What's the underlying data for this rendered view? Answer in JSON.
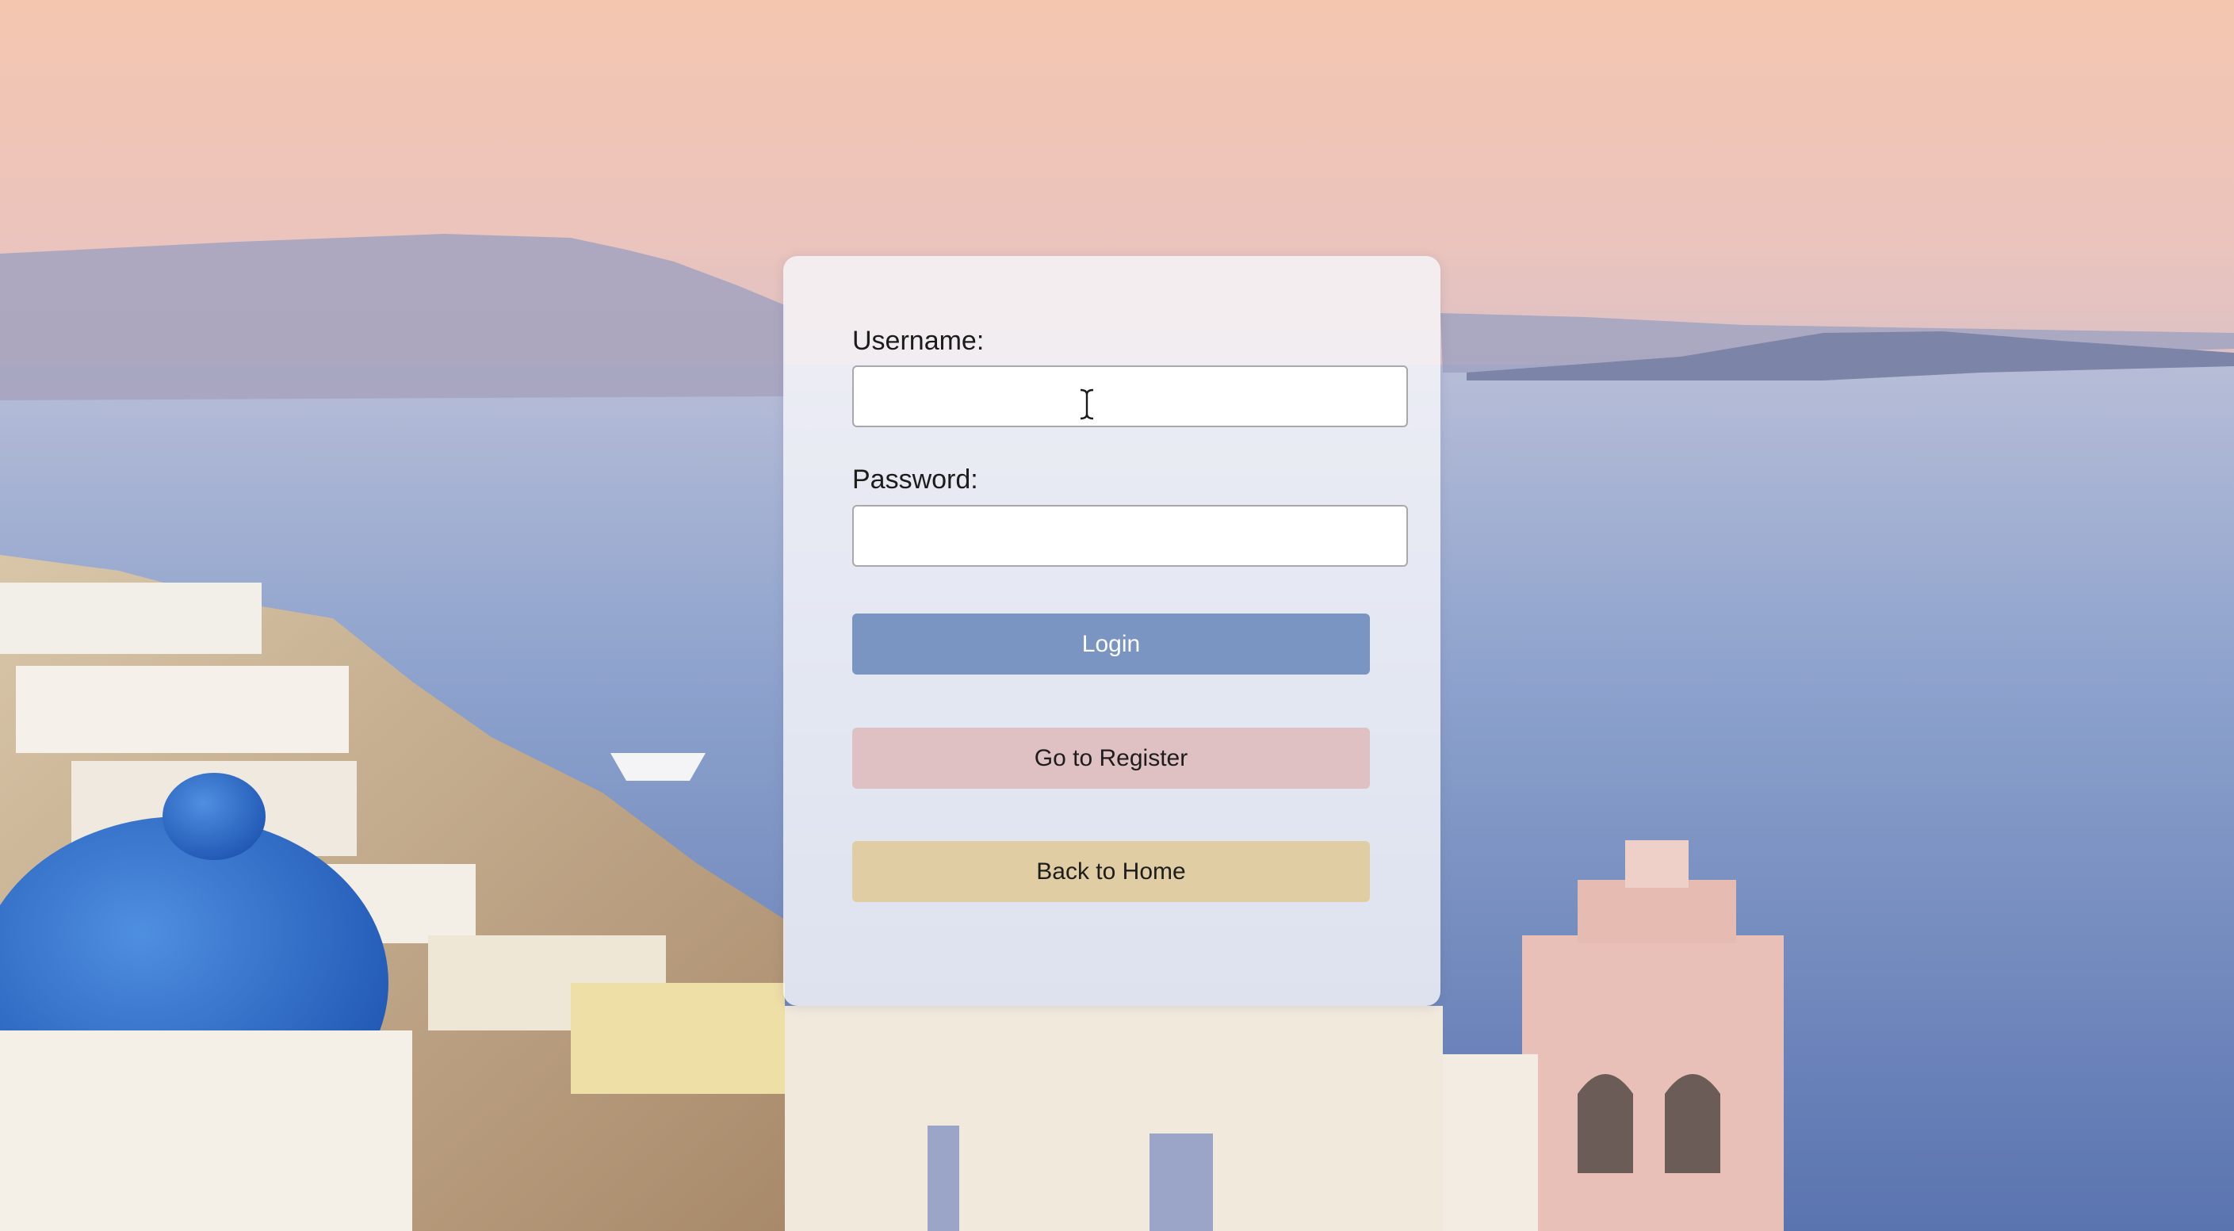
{
  "login_form": {
    "username_label": "Username:",
    "username_value": "",
    "password_label": "Password:",
    "password_value": "",
    "login_button": "Login",
    "register_button": "Go to Register",
    "home_button": "Back to Home"
  },
  "colors": {
    "login_button": "#7a95c2",
    "register_button": "#dfc0c3",
    "home_button": "#e0cda3",
    "card_background": "#f6f6fa"
  },
  "icons": {
    "cursor": "text-cursor-icon"
  }
}
